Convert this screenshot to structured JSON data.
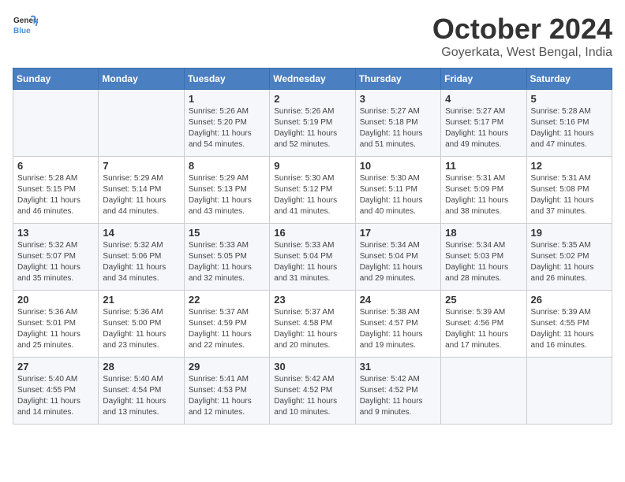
{
  "logo": {
    "general": "General",
    "blue": "Blue"
  },
  "title": "October 2024",
  "location": "Goyerkata, West Bengal, India",
  "weekdays": [
    "Sunday",
    "Monday",
    "Tuesday",
    "Wednesday",
    "Thursday",
    "Friday",
    "Saturday"
  ],
  "weeks": [
    [
      {
        "day": "",
        "sunrise": "",
        "sunset": "",
        "daylight": ""
      },
      {
        "day": "",
        "sunrise": "",
        "sunset": "",
        "daylight": ""
      },
      {
        "day": "1",
        "sunrise": "Sunrise: 5:26 AM",
        "sunset": "Sunset: 5:20 PM",
        "daylight": "Daylight: 11 hours and 54 minutes."
      },
      {
        "day": "2",
        "sunrise": "Sunrise: 5:26 AM",
        "sunset": "Sunset: 5:19 PM",
        "daylight": "Daylight: 11 hours and 52 minutes."
      },
      {
        "day": "3",
        "sunrise": "Sunrise: 5:27 AM",
        "sunset": "Sunset: 5:18 PM",
        "daylight": "Daylight: 11 hours and 51 minutes."
      },
      {
        "day": "4",
        "sunrise": "Sunrise: 5:27 AM",
        "sunset": "Sunset: 5:17 PM",
        "daylight": "Daylight: 11 hours and 49 minutes."
      },
      {
        "day": "5",
        "sunrise": "Sunrise: 5:28 AM",
        "sunset": "Sunset: 5:16 PM",
        "daylight": "Daylight: 11 hours and 47 minutes."
      }
    ],
    [
      {
        "day": "6",
        "sunrise": "Sunrise: 5:28 AM",
        "sunset": "Sunset: 5:15 PM",
        "daylight": "Daylight: 11 hours and 46 minutes."
      },
      {
        "day": "7",
        "sunrise": "Sunrise: 5:29 AM",
        "sunset": "Sunset: 5:14 PM",
        "daylight": "Daylight: 11 hours and 44 minutes."
      },
      {
        "day": "8",
        "sunrise": "Sunrise: 5:29 AM",
        "sunset": "Sunset: 5:13 PM",
        "daylight": "Daylight: 11 hours and 43 minutes."
      },
      {
        "day": "9",
        "sunrise": "Sunrise: 5:30 AM",
        "sunset": "Sunset: 5:12 PM",
        "daylight": "Daylight: 11 hours and 41 minutes."
      },
      {
        "day": "10",
        "sunrise": "Sunrise: 5:30 AM",
        "sunset": "Sunset: 5:11 PM",
        "daylight": "Daylight: 11 hours and 40 minutes."
      },
      {
        "day": "11",
        "sunrise": "Sunrise: 5:31 AM",
        "sunset": "Sunset: 5:09 PM",
        "daylight": "Daylight: 11 hours and 38 minutes."
      },
      {
        "day": "12",
        "sunrise": "Sunrise: 5:31 AM",
        "sunset": "Sunset: 5:08 PM",
        "daylight": "Daylight: 11 hours and 37 minutes."
      }
    ],
    [
      {
        "day": "13",
        "sunrise": "Sunrise: 5:32 AM",
        "sunset": "Sunset: 5:07 PM",
        "daylight": "Daylight: 11 hours and 35 minutes."
      },
      {
        "day": "14",
        "sunrise": "Sunrise: 5:32 AM",
        "sunset": "Sunset: 5:06 PM",
        "daylight": "Daylight: 11 hours and 34 minutes."
      },
      {
        "day": "15",
        "sunrise": "Sunrise: 5:33 AM",
        "sunset": "Sunset: 5:05 PM",
        "daylight": "Daylight: 11 hours and 32 minutes."
      },
      {
        "day": "16",
        "sunrise": "Sunrise: 5:33 AM",
        "sunset": "Sunset: 5:04 PM",
        "daylight": "Daylight: 11 hours and 31 minutes."
      },
      {
        "day": "17",
        "sunrise": "Sunrise: 5:34 AM",
        "sunset": "Sunset: 5:04 PM",
        "daylight": "Daylight: 11 hours and 29 minutes."
      },
      {
        "day": "18",
        "sunrise": "Sunrise: 5:34 AM",
        "sunset": "Sunset: 5:03 PM",
        "daylight": "Daylight: 11 hours and 28 minutes."
      },
      {
        "day": "19",
        "sunrise": "Sunrise: 5:35 AM",
        "sunset": "Sunset: 5:02 PM",
        "daylight": "Daylight: 11 hours and 26 minutes."
      }
    ],
    [
      {
        "day": "20",
        "sunrise": "Sunrise: 5:36 AM",
        "sunset": "Sunset: 5:01 PM",
        "daylight": "Daylight: 11 hours and 25 minutes."
      },
      {
        "day": "21",
        "sunrise": "Sunrise: 5:36 AM",
        "sunset": "Sunset: 5:00 PM",
        "daylight": "Daylight: 11 hours and 23 minutes."
      },
      {
        "day": "22",
        "sunrise": "Sunrise: 5:37 AM",
        "sunset": "Sunset: 4:59 PM",
        "daylight": "Daylight: 11 hours and 22 minutes."
      },
      {
        "day": "23",
        "sunrise": "Sunrise: 5:37 AM",
        "sunset": "Sunset: 4:58 PM",
        "daylight": "Daylight: 11 hours and 20 minutes."
      },
      {
        "day": "24",
        "sunrise": "Sunrise: 5:38 AM",
        "sunset": "Sunset: 4:57 PM",
        "daylight": "Daylight: 11 hours and 19 minutes."
      },
      {
        "day": "25",
        "sunrise": "Sunrise: 5:39 AM",
        "sunset": "Sunset: 4:56 PM",
        "daylight": "Daylight: 11 hours and 17 minutes."
      },
      {
        "day": "26",
        "sunrise": "Sunrise: 5:39 AM",
        "sunset": "Sunset: 4:55 PM",
        "daylight": "Daylight: 11 hours and 16 minutes."
      }
    ],
    [
      {
        "day": "27",
        "sunrise": "Sunrise: 5:40 AM",
        "sunset": "Sunset: 4:55 PM",
        "daylight": "Daylight: 11 hours and 14 minutes."
      },
      {
        "day": "28",
        "sunrise": "Sunrise: 5:40 AM",
        "sunset": "Sunset: 4:54 PM",
        "daylight": "Daylight: 11 hours and 13 minutes."
      },
      {
        "day": "29",
        "sunrise": "Sunrise: 5:41 AM",
        "sunset": "Sunset: 4:53 PM",
        "daylight": "Daylight: 11 hours and 12 minutes."
      },
      {
        "day": "30",
        "sunrise": "Sunrise: 5:42 AM",
        "sunset": "Sunset: 4:52 PM",
        "daylight": "Daylight: 11 hours and 10 minutes."
      },
      {
        "day": "31",
        "sunrise": "Sunrise: 5:42 AM",
        "sunset": "Sunset: 4:52 PM",
        "daylight": "Daylight: 11 hours and 9 minutes."
      },
      {
        "day": "",
        "sunrise": "",
        "sunset": "",
        "daylight": ""
      },
      {
        "day": "",
        "sunrise": "",
        "sunset": "",
        "daylight": ""
      }
    ]
  ]
}
